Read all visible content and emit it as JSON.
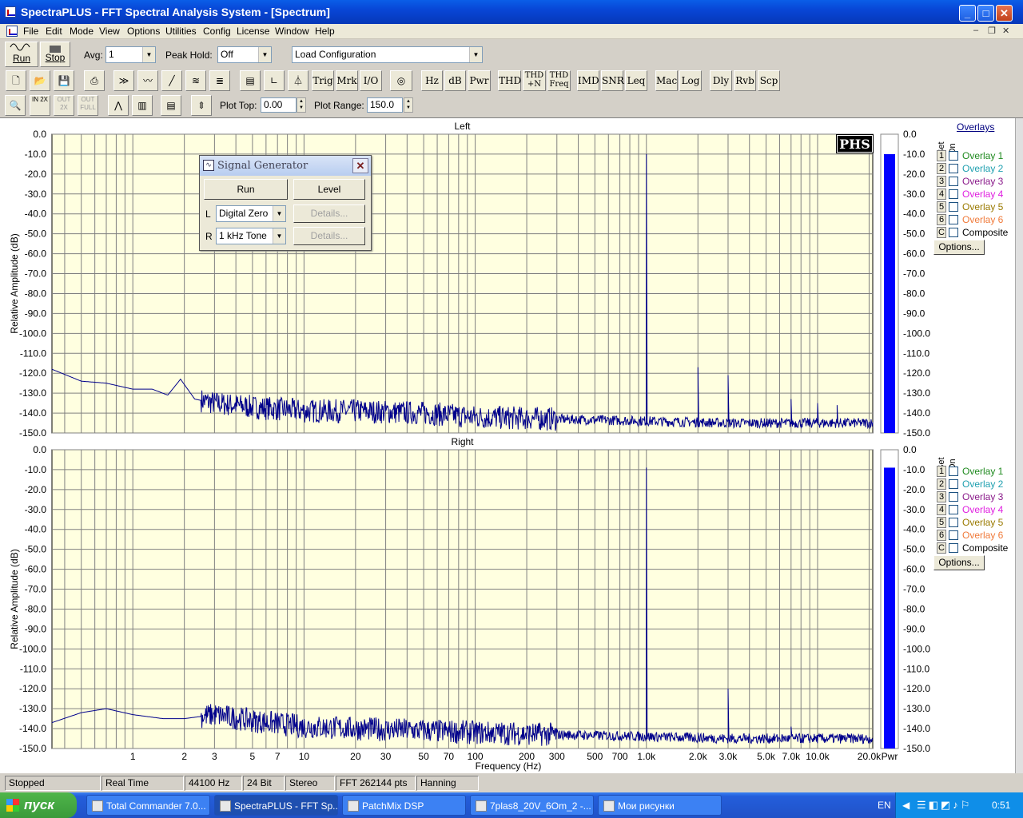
{
  "window": {
    "title": "SpectraPLUS - FFT Spectral Analysis System - [Spectrum]"
  },
  "menu": [
    "File",
    "Edit",
    "Mode",
    "View",
    "Options",
    "Utilities",
    "Config",
    "License",
    "Window",
    "Help"
  ],
  "toolbar1": {
    "run_label": "Run",
    "stop_label": "Stop",
    "avg_label": "Avg:",
    "avg_value": "1",
    "peak_hold_label": "Peak Hold:",
    "peak_hold_value": "Off",
    "config_value": "Load Configuration"
  },
  "toolbar2": [
    "Trig",
    "Mrk",
    "I/O",
    "Hz",
    "dB",
    "Pwr",
    "THD",
    "THD +N",
    "THD Freq",
    "IMD",
    "SNR",
    "Leq",
    "Mac",
    "Log",
    "Dly",
    "Rvb",
    "Scp"
  ],
  "toolbar3": {
    "zoom_in": "IN 2X",
    "zoom_out": "OUT 2X",
    "zoom_full": "OUT FULL",
    "plot_top_label": "Plot Top:",
    "plot_top_value": "0.00",
    "plot_range_label": "Plot Range:",
    "plot_range_value": "150.0"
  },
  "chart_data": [
    {
      "type": "line",
      "title": "Left",
      "xlabel": "Frequency (Hz)",
      "ylabel": "Relative Amplitude (dB)",
      "x_scale": "log",
      "xlim": [
        0.337,
        21000
      ],
      "ylim": [
        -150,
        0
      ],
      "x_ticks": [
        "1",
        "2",
        "3",
        "5",
        "7",
        "10",
        "20",
        "30",
        "50",
        "70",
        "100",
        "200",
        "300",
        "500",
        "700",
        "1.0k",
        "2.0k",
        "3.0k",
        "5.0k",
        "7.0k",
        "10.0k",
        "20.0k"
      ],
      "y_ticks": [
        "0.0",
        "-10.0",
        "-20.0",
        "-30.0",
        "-40.0",
        "-50.0",
        "-60.0",
        "-70.0",
        "-80.0",
        "-90.0",
        "-100.0",
        "-110.0",
        "-120.0",
        "-130.0",
        "-140.0",
        "-150.0"
      ],
      "grid": true,
      "noise_floor": [
        [
          0.337,
          -118
        ],
        [
          0.5,
          -124
        ],
        [
          0.7,
          -125
        ],
        [
          1,
          -128
        ],
        [
          1.3,
          -128
        ],
        [
          1.6,
          -131
        ],
        [
          1.9,
          -123
        ],
        [
          2.3,
          -133
        ],
        [
          3,
          -135
        ],
        [
          5,
          -137
        ],
        [
          10,
          -139
        ],
        [
          20,
          -139
        ],
        [
          50,
          -140
        ],
        [
          100,
          -142
        ],
        [
          300,
          -143
        ],
        [
          1000,
          -144
        ],
        [
          3000,
          -145
        ],
        [
          10000,
          -145
        ],
        [
          21000,
          -145
        ]
      ],
      "peaks": [
        {
          "x": 1000,
          "y": -10
        },
        {
          "x": 2000,
          "y": -117
        },
        {
          "x": 3000,
          "y": -121
        },
        {
          "x": 7000,
          "y": -133
        },
        {
          "x": 10000,
          "y": -135
        },
        {
          "x": 13000,
          "y": -136
        }
      ],
      "power_bar_db": -10,
      "power_label": "Pwr",
      "series": [
        {
          "name": "Left",
          "color": "#00008b"
        }
      ]
    },
    {
      "type": "line",
      "title": "Right",
      "xlabel": "Frequency (Hz)",
      "ylabel": "Relative Amplitude (dB)",
      "x_scale": "log",
      "xlim": [
        0.337,
        21000
      ],
      "ylim": [
        -150,
        0
      ],
      "grid": true,
      "noise_floor": [
        [
          0.337,
          -137
        ],
        [
          0.5,
          -132
        ],
        [
          0.7,
          -130
        ],
        [
          1,
          -133
        ],
        [
          1.5,
          -135
        ],
        [
          2,
          -135
        ],
        [
          3,
          -133
        ],
        [
          5,
          -136
        ],
        [
          10,
          -139
        ],
        [
          20,
          -140
        ],
        [
          50,
          -141
        ],
        [
          100,
          -142
        ],
        [
          300,
          -143
        ],
        [
          1000,
          -144
        ],
        [
          3000,
          -145
        ],
        [
          10000,
          -145
        ],
        [
          21000,
          -145
        ]
      ],
      "peaks": [
        {
          "x": 1000,
          "y": -9
        },
        {
          "x": 2000,
          "y": -142
        },
        {
          "x": 3000,
          "y": -120
        },
        {
          "x": 7000,
          "y": -139
        }
      ],
      "power_bar_db": -9,
      "series": [
        {
          "name": "Right",
          "color": "#00008b"
        }
      ]
    }
  ],
  "overlays": {
    "title": "Overlays",
    "set_label": "Set",
    "on_label": "On",
    "items": [
      {
        "num": "1",
        "label": "Overlay 1",
        "color": "#1f8a1f"
      },
      {
        "num": "2",
        "label": "Overlay 2",
        "color": "#20a0b0"
      },
      {
        "num": "3",
        "label": "Overlay 3",
        "color": "#8a1a8a"
      },
      {
        "num": "4",
        "label": "Overlay 4",
        "color": "#e020e0"
      },
      {
        "num": "5",
        "label": "Overlay 5",
        "color": "#9a7a00"
      },
      {
        "num": "6",
        "label": "Overlay 6",
        "color": "#f07a3a"
      },
      {
        "num": "C",
        "label": "Composite",
        "color": "#000000"
      }
    ],
    "options_label": "Options..."
  },
  "phs_logo": "PHS",
  "signal_generator": {
    "title": "Signal Generator",
    "run_label": "Run",
    "level_label": "Level",
    "l_label": "L",
    "l_value": "Digital Zero",
    "r_label": "R",
    "r_value": "1 kHz Tone",
    "details_label": "Details..."
  },
  "status": [
    "Stopped",
    "Real Time",
    "44100 Hz",
    "24 Bit",
    "Stereo",
    "FFT 262144 pts",
    "Hanning"
  ],
  "taskbar": {
    "start_label": "пуск",
    "tasks": [
      "Total Commander 7.0...",
      "SpectraPLUS - FFT Sp...",
      "PatchMix DSP",
      "7plas8_20V_6Om_2 -...",
      "Мои рисунки"
    ],
    "lang": "EN",
    "clock": "0:51"
  }
}
